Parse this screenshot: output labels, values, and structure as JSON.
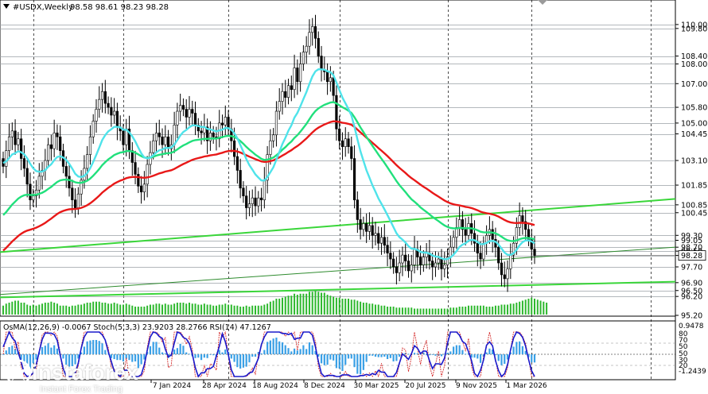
{
  "header": {
    "symbol": "#USDX,Weekly",
    "ohlc": "98.58 98.61 98.23 98.28"
  },
  "indicator_header": "OsMA(12,26,9) -0.0067 Stoch(5,3,3) 23.9203 28.2766 RSI(14) 47.1267",
  "brand": {
    "name": "instaforex",
    "tagline": "Instant Forex Trading"
  },
  "colors": {
    "ema200": "#e81818",
    "ema144": "#21e07c",
    "ema50": "#4fe3ea",
    "trend": "#3ad63a",
    "osma": "#3aa0e6",
    "stoch_main": "#1a1acc",
    "stoch_signal": "#d01414",
    "bid_line": "#7a7a7a"
  },
  "chart_data": {
    "type": "candlestick",
    "title": "#USDX,Weekly",
    "ylim": [
      95.2,
      110.6
    ],
    "price_labels": [
      "110.00",
      "109.80",
      "108.40",
      "108.00",
      "107.00",
      "105.80",
      "105.00",
      "104.45",
      "103.10",
      "101.85",
      "100.85",
      "100.45",
      "99.30",
      "99.05",
      "98.70",
      "98.50",
      "98.28",
      "97.70",
      "96.90",
      "96.50",
      "96.20",
      "95.20"
    ],
    "highlighted_labels": [
      "98.28"
    ],
    "x_tick_labels": [
      "7 Jan 2024",
      "28 Apr 2024",
      "18 Aug 2024",
      "8 Dec 2024",
      "30 Mar 2025",
      "20 Jul 2025",
      "9 Nov 2025",
      "1 Mar 2026"
    ],
    "close_series": [
      102.8,
      103.6,
      104.3,
      104.6,
      103.9,
      104.2,
      103.2,
      102.7,
      101.9,
      101.1,
      101.3,
      101.6,
      102.3,
      102.6,
      103.1,
      103.9,
      103.7,
      104.5,
      104.3,
      103.6,
      102.8,
      102.3,
      101.7,
      101.1,
      100.7,
      101.4,
      102.1,
      102.7,
      103.4,
      104.3,
      105.1,
      105.7,
      106.2,
      106.6,
      106.0,
      105.8,
      105.4,
      105.6,
      104.8,
      104.6,
      103.9,
      104.7,
      103.6,
      103.0,
      102.4,
      101.8,
      101.5,
      101.9,
      102.9,
      103.5,
      104.1,
      104.5,
      104.3,
      103.9,
      104.3,
      103.7,
      103.9,
      104.9,
      105.6,
      105.9,
      105.7,
      105.3,
      105.7,
      105.5,
      104.9,
      104.6,
      104.5,
      104.8,
      104.1,
      104.5,
      104.3,
      104.2,
      105.0,
      104.9,
      105.3,
      104.7,
      104.1,
      103.3,
      102.6,
      101.7,
      101.3,
      100.7,
      100.9,
      101.2,
      100.8,
      101.2,
      101.1,
      102.1,
      103.4,
      104.1,
      104.4,
      105.6,
      106.1,
      106.6,
      106.3,
      106.9,
      106.7,
      107.8,
      107.1,
      108.0,
      108.6,
      108.9,
      109.6,
      109.9,
      109.3,
      108.4,
      107.7,
      107.6,
      107.1,
      107.3,
      106.4,
      104.7,
      104.1,
      103.8,
      104.2,
      103.8,
      103.2,
      101.1,
      100.1,
      99.6,
      99.9,
      99.5,
      99.8,
      99.3,
      99.4,
      98.9,
      99.2,
      98.8,
      98.4,
      98.1,
      97.7,
      97.4,
      97.9,
      98.3,
      98.0,
      97.5,
      97.8,
      98.6,
      98.2,
      97.8,
      98.2,
      98.4,
      98.0,
      97.7,
      97.9,
      98.1,
      97.6,
      97.8,
      98.2,
      98.7,
      99.2,
      99.7,
      100.1,
      99.6,
      99.3,
      99.9,
      99.4,
      98.9,
      98.4,
      98.1,
      98.9,
      99.3,
      99.6,
      99.1,
      98.7,
      97.9,
      97.3,
      97.1,
      97.6,
      98.3,
      98.9,
      99.7,
      100.3,
      100.0,
      99.6,
      99.1,
      98.6,
      98.28
    ],
    "volume_series": [
      9,
      11,
      12,
      13,
      14,
      14,
      12,
      12,
      10,
      9,
      10,
      9,
      10,
      11,
      12,
      12,
      13,
      12,
      11,
      9,
      9,
      9,
      8,
      9,
      9,
      10,
      10,
      11,
      12,
      12,
      13,
      13,
      13,
      12,
      12,
      11,
      11,
      12,
      11,
      10,
      10,
      11,
      10,
      9,
      8,
      8,
      8,
      8,
      9,
      10,
      10,
      11,
      11,
      10,
      11,
      10,
      10,
      11,
      12,
      12,
      12,
      11,
      12,
      11,
      11,
      10,
      10,
      11,
      10,
      10,
      9,
      9,
      10,
      10,
      11,
      10,
      10,
      9,
      9,
      8,
      8,
      9,
      8,
      9,
      9,
      9,
      9,
      10,
      11,
      13,
      14,
      16,
      16,
      17,
      18,
      19,
      19,
      21,
      20,
      21,
      21,
      21,
      23,
      23,
      24,
      23,
      22,
      22,
      20,
      19,
      18,
      17,
      17,
      16,
      16,
      16,
      15,
      15,
      14,
      13,
      12,
      12,
      11,
      11,
      10,
      10,
      9,
      9,
      8,
      8,
      8,
      7,
      7,
      7,
      7,
      7,
      7,
      6,
      6,
      6,
      6,
      6,
      6,
      6,
      6,
      6,
      6,
      6,
      6,
      7,
      7,
      7,
      8,
      8,
      8,
      9,
      9,
      9,
      9,
      9,
      9,
      8,
      8,
      8,
      9,
      9,
      10,
      10,
      10,
      11,
      11,
      12,
      13,
      14,
      15,
      16,
      17,
      16,
      15,
      14,
      13,
      12
    ],
    "moving_averages": [
      "EMA50 (cyan)",
      "EMA144 (green)",
      "EMA200 (red)"
    ],
    "lower_indicators": {
      "osma": {
        "params": "12,26,9",
        "value": -0.0067
      },
      "stoch": {
        "params": "5,3,3",
        "main": 23.9203,
        "signal": 28.2766
      },
      "rsi": {
        "params": "14",
        "value": 47.1267
      },
      "scale_labels": [
        "0.9478",
        "80",
        "70",
        "50",
        "50",
        "30",
        "20",
        "-1.2439"
      ]
    },
    "grid": "vertical period separators",
    "legend": "none"
  }
}
